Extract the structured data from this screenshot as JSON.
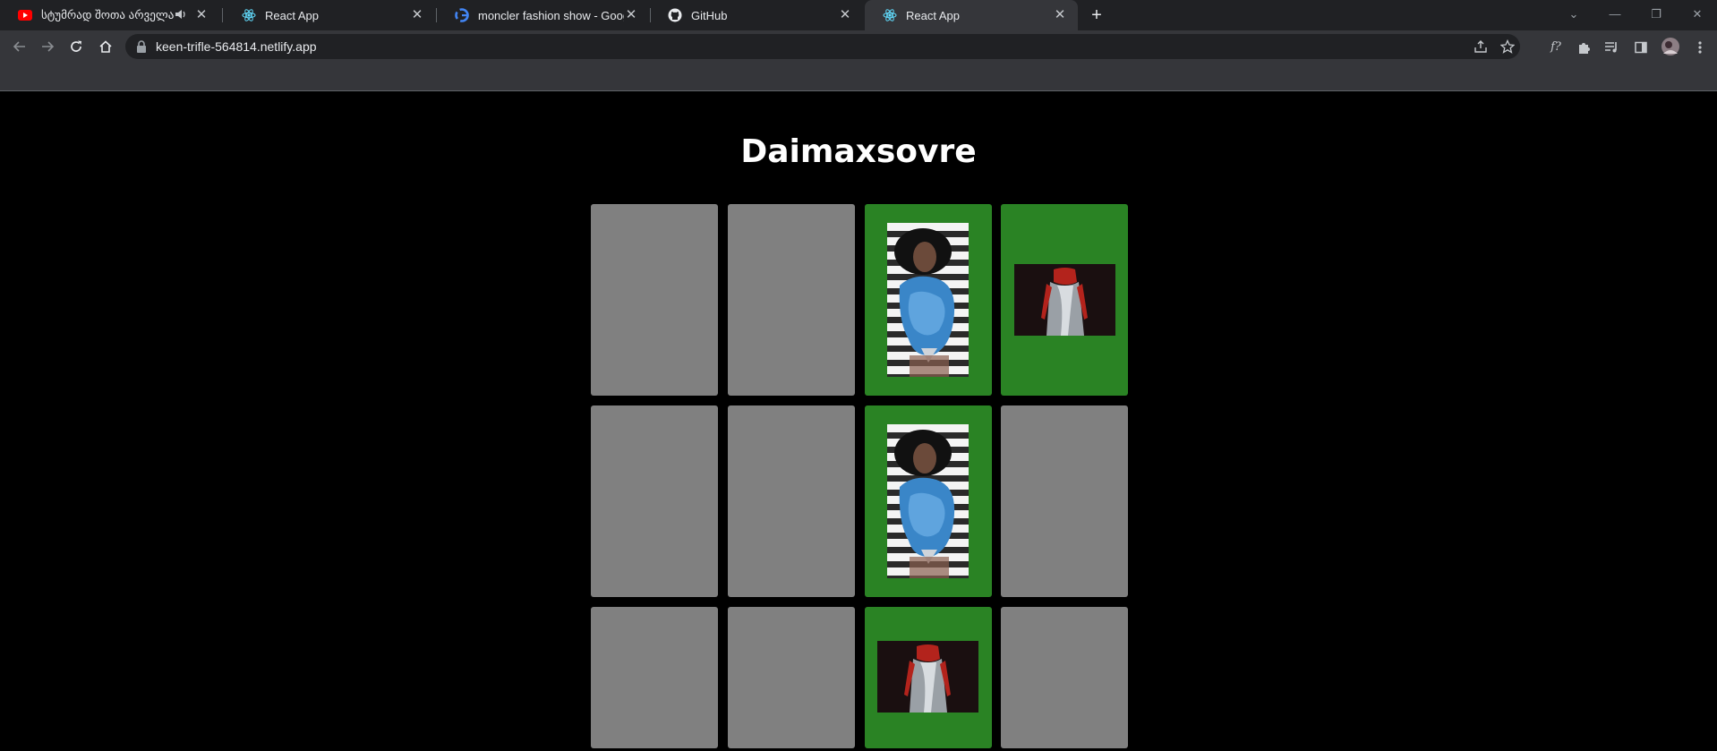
{
  "browser": {
    "tabs": [
      {
        "title": "სტუმრად შოთა არველაძ",
        "favicon": "youtube-icon",
        "muted": true
      },
      {
        "title": "React App",
        "favicon": "react-icon"
      },
      {
        "title": "moncler fashion show - Google S",
        "favicon": "google-icon"
      },
      {
        "title": "GitHub",
        "favicon": "github-icon"
      },
      {
        "title": "React App",
        "favicon": "react-icon",
        "active": true
      }
    ],
    "url": "keen-trifle-564814.netlify.app"
  },
  "game": {
    "title": "Daimaxsovre",
    "cards": [
      {
        "state": "hidden"
      },
      {
        "state": "hidden"
      },
      {
        "state": "matched",
        "image": "woman-blue-feathers-photo"
      },
      {
        "state": "matched",
        "image": "silver-dress-red-gloves-photo"
      },
      {
        "state": "hidden"
      },
      {
        "state": "hidden"
      },
      {
        "state": "matched",
        "image": "woman-blue-feathers-photo"
      },
      {
        "state": "hidden"
      },
      {
        "state": "hidden"
      },
      {
        "state": "hidden"
      },
      {
        "state": "matched",
        "image": "silver-dress-red-gloves-photo"
      },
      {
        "state": "hidden"
      }
    ]
  },
  "colors": {
    "matched": "#2a8324",
    "hidden": "#808080",
    "background": "#000000"
  }
}
